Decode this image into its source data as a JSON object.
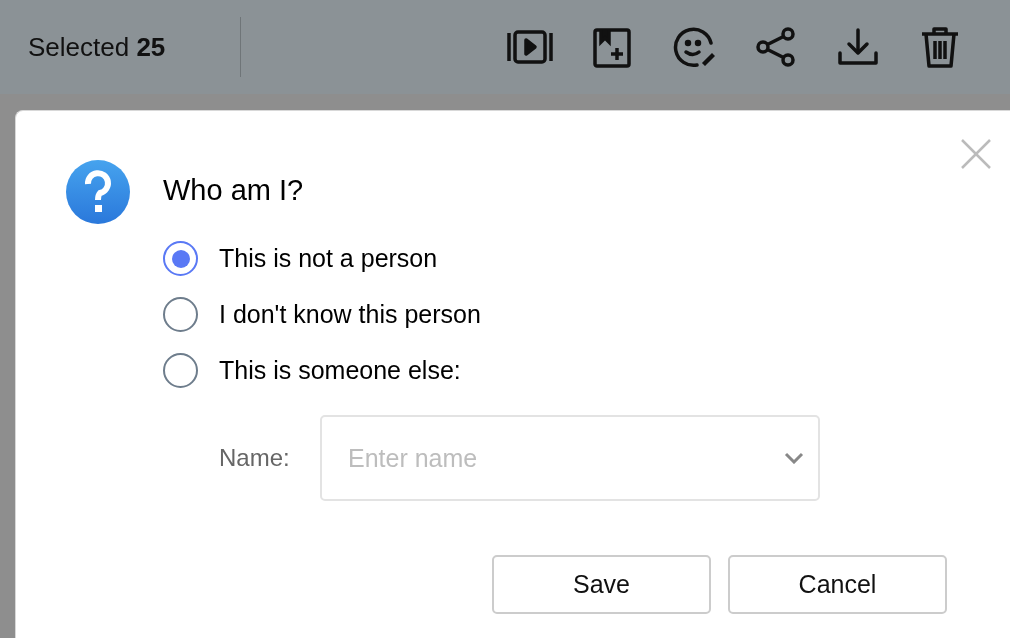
{
  "toolbar": {
    "selection_text": "Selected **25**"
  },
  "dialog": {
    "title": "Who am I?",
    "options": [
      {
        "label": "This is not a person",
        "selected": true
      },
      {
        "label": "I don't know this person",
        "selected": false
      },
      {
        "label": "This is someone else:",
        "selected": false
      }
    ],
    "name_field": {
      "label": "Name:",
      "placeholder": "Enter name"
    },
    "buttons": [
      "Save",
      "Cancel"
    ]
  }
}
